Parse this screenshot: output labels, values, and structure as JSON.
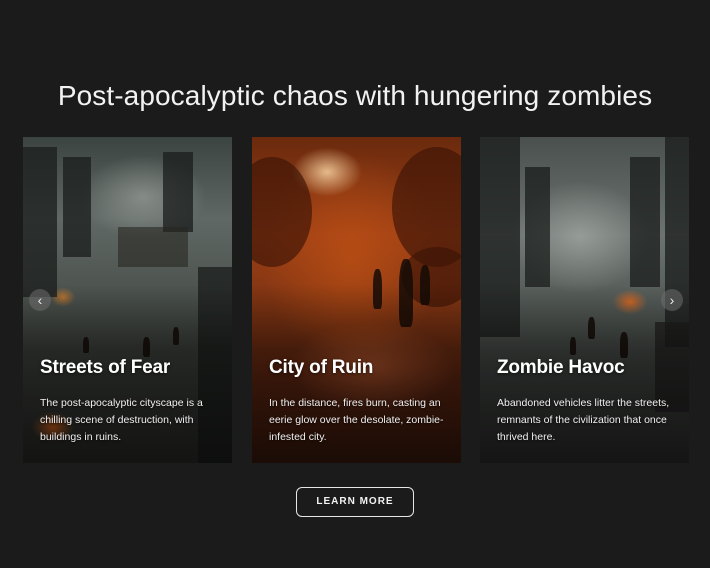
{
  "section": {
    "headline": "Post-apocalyptic chaos with hungering zombies"
  },
  "carousel": {
    "prev_icon": "‹",
    "next_icon": "›",
    "cards": [
      {
        "title": "Streets of Fear",
        "description": "The post-apocalyptic cityscape is a chilling scene of destruction, with buildings in ruins."
      },
      {
        "title": "City of Ruin",
        "description": "In the distance, fires burn, casting an eerie glow over the desolate, zombie-infested city."
      },
      {
        "title": "Zombie Havoc",
        "description": "Abandoned vehicles litter the streets, remnants of the civilization that once thrived here."
      }
    ]
  },
  "cta": {
    "label": "LEARN MORE"
  },
  "colors": {
    "page_background": "#1b1b1b",
    "text": "#ffffff",
    "button_border": "#e6e6e6"
  }
}
